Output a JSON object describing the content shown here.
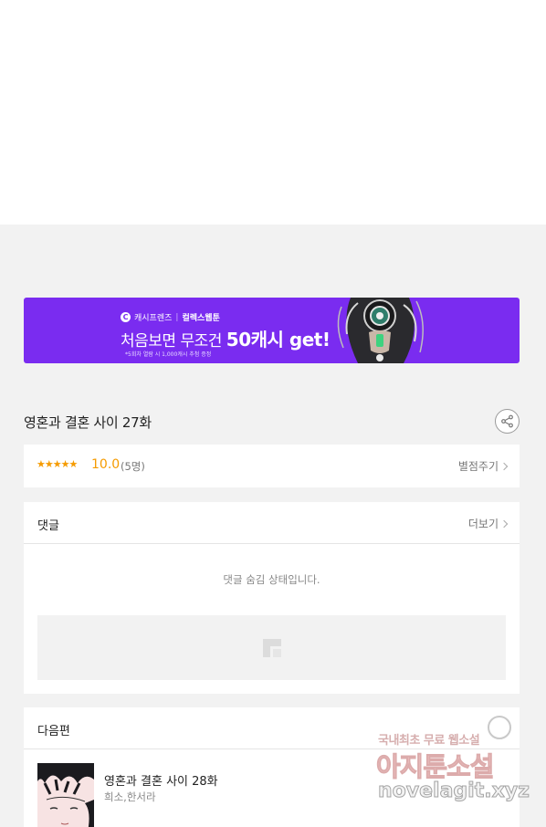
{
  "banner": {
    "brand_logo": "C",
    "brand_name": "캐시프렌즈",
    "brand_separator": "|",
    "brand_partner": "컬렉스웹툰",
    "headline_prefix": "처음보면 무조건",
    "headline_highlight": "50캐시 get!!",
    "fine_print": "*5회차 열람 시 1,000캐시 추첨 증정"
  },
  "episode": {
    "title": "영혼과 결혼 사이 27화",
    "share_icon": "share-icon"
  },
  "rating": {
    "stars": "★★★★★",
    "score": "10.0",
    "count": "(5명)",
    "rate_label": "별점주기"
  },
  "comments": {
    "title": "댓글",
    "more_label": "더보기",
    "hidden_message": "댓글 숨김 상태입니다."
  },
  "next_episode": {
    "section_title": "다음편",
    "title": "영혼과 결혼 사이 28화",
    "authors": "희소,한서라"
  },
  "watermark": {
    "line1": "국내최초 무료 웹소설",
    "line2": "아지툰소설",
    "line3": "novelagit.xyz"
  },
  "colors": {
    "banner_bg": "#7a2cf0",
    "rating_accent": "#f59b00",
    "page_bg": "#f2f2f2"
  }
}
